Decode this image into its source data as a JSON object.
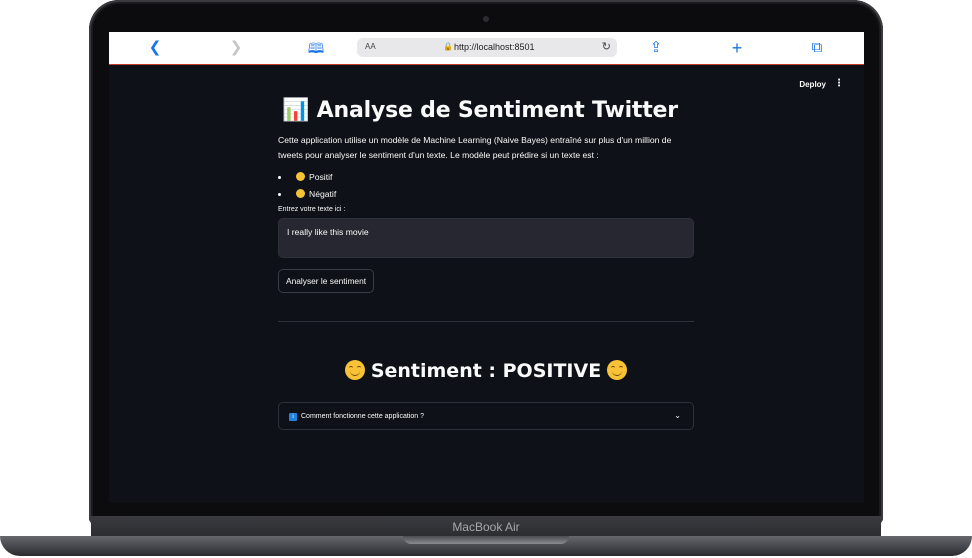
{
  "browser": {
    "url": "http://localhost:8501",
    "text_size_label": "AA",
    "icons": [
      "chevron-left-icon",
      "chevron-right-icon",
      "book-icon",
      "lock-icon",
      "reload-icon",
      "share-icon",
      "plus-icon",
      "tabs-icon"
    ]
  },
  "header": {
    "deploy_label": "Deploy",
    "menu_label": "⋮"
  },
  "main": {
    "title_emoji": "📊",
    "title": "Analyse de Sentiment Twitter",
    "intro": "Cette application utilise un modèle de Machine Learning (Naive Bayes) entraîné sur plus d'un million de tweets pour analyser le sentiment d'un texte. Le modèle peut prédire si un texte est :",
    "options": [
      {
        "label": "Positif"
      },
      {
        "label": "Négatif"
      }
    ],
    "input_label": "Entrez votre texte ici :",
    "input_value": "I really like this movie",
    "analyze_button": "Analyser le sentiment",
    "result_text": "Sentiment : POSITIVE",
    "expander_label": "Comment fonctionne cette application ?",
    "expander_icon": "i"
  },
  "device": {
    "label": "MacBook Air"
  },
  "colors": {
    "background": "#0e1117",
    "input_bg": "#262730",
    "accent": "#1a73e8",
    "text": "#fafafa"
  }
}
